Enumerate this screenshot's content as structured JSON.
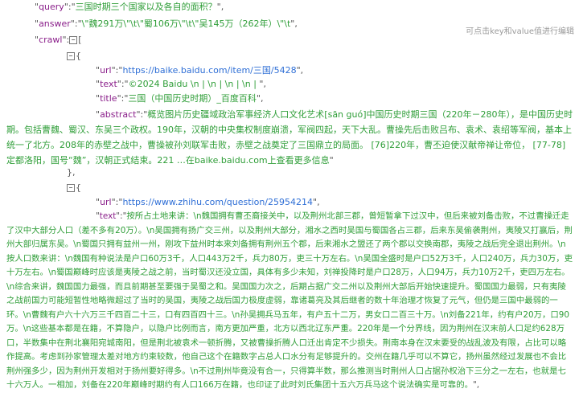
{
  "hint": "可点击key和value值进行编辑",
  "json": {
    "query_key": "query",
    "query_value": "三国时期三个国家以及各自的面积？",
    "answer_key": "answer",
    "answer_value": "\\\"魏291万\\\"\\t\\\"蜀106万\\\"\\t\\\"吴145万（262年）\\\"\\t",
    "crawl_key": "crawl",
    "items": [
      {
        "url_key": "url",
        "url": "https://baike.baidu.com/item/三国/5428",
        "text_key": "text",
        "text_value": "©2024  Baidu  \\n  |  \\n  |  \\n  |  \\n  |  ",
        "title_key": "title",
        "title_value": "三国（中国历史时期）_百度百科",
        "abstract_key": "abstract",
        "abstract_value": "概览图片历史疆域政治军事经济人口文化艺术[sān  guó]中国历史时期三国（220年－280年），是中国历史时期。包括曹魏、蜀汉、东吴三个政权。190年，汉朝的中央集权制度崩溃，军阀四起，天下大乱。曹操先后击败吕布、袁术、袁绍等军阀，基本上统一了北方。208年的赤壁之战中，曹操被孙刘联军击败，赤壁之战奠定了三国鼎立的局面。  [76]220年，曹丕迫使汉献帝禅让帝位，  [77-78]定都洛阳，国号“魏”，汉朝正式结束。221  …在baike.baidu.com上查看更多信息"
      },
      {
        "url_key": "url",
        "url": "https://www.zhihu.com/question/25954214",
        "text_key": "text",
        "text_value": "按所占土地来讲：\\n魏国拥有曹丕裔接关中，以及荆州北部三郡，曾短暂拿下过汉中，但后来被刘备击败，不过曹操迁走了汉中大部分人口（差不多有20万）。\\n吴国拥有扬广交三州，以及荆州大部分，湘水之西时吴国与蜀国各占三郡，后来东吴偷袭荆州，夷陵又打赢后，荆州大部归属东吴。\\n蜀国只拥有益州一州，刚攻下益州时本来刘备拥有荆州五个郡，后来湘水之盟还了两个郡以交换南郡，夷陵之战后完全退出荆州。\\n按人口数来讲：\\n魏国有种说法是户口60万3千，人口443万2千，兵力80万，吏三十万左右。\\n吴国全盛时是户口52万3千，人口240万，兵力30万，吏十万左右。\\n蜀国巅峰时应该是夷陵之战之前，当时蜀汉还没立国，具体有多少未知，刘禅投降时是户口28万，人口94万，兵力10万2千，吏四万左右。\\n综合来讲，魏国国力最强，而且前期甚至要强于吴蜀之和。吴国国力次之，后期占据广交二州以及荆州大部后开始快速提升。蜀国国力最弱，只有夷陵之战前国力可能短暂性地略微超过了当时的吴国，夷陵之战后国力极度虚弱，靠诸葛亮及其后继者的数十年治理才恢复了元气，但仍是三国中最弱的一环。\\n曹魏有户六十六万三千四百二十三，口有四百四十三。\\n孙吴拥兵马五年，有户五十二万，男女口二百三十万。\\n刘备221年，约有户20万，口90万。\\n这些基本都是在籍，不算隐户，以隐户比例而言，南方更加严重，北方以西北辽东严重。220年是一个分界线，因为荆州在汉末前人口足约628万口，半数集中在荆北襄阳宛城南阳，但是荆北被袁术一顿折腾，又被曹操折腾人口迁出肯定不少损失。荆南本身在汉末要受的战乱波及有限，占比可以略作提高。考虑到孙家管理太差对地方约束较数，他自己这个在籍数字占总人口水分有足够提升的。交州在籍几乎可以不算它，扬州虽然经过发展也不会比荆州强多少，因为荆州开发相对于扬州要好得多。\\n不过荆州毕竟没有合一，只得算半数，那么推测当时荆州人口占据孙权治下三分之一左右，也就是七十六万人。一相加，刘备在220年巅峰时期约有人口166万在籍，也印证了此时刘氏集团十五六万兵马这个说法确实是可靠的。"
      }
    ]
  }
}
